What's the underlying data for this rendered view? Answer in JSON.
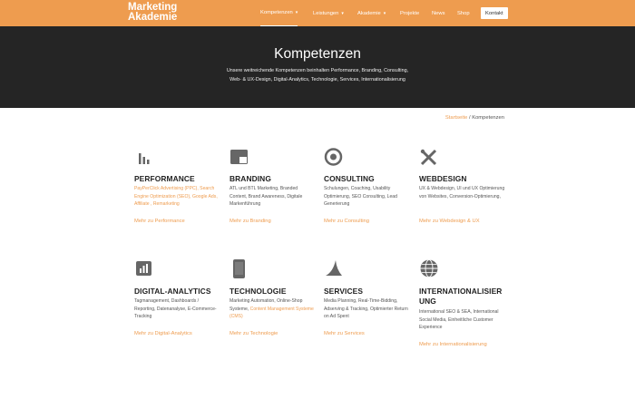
{
  "header": {
    "logo_line1": "Marketing",
    "logo_line2": "Akademie",
    "nav": [
      {
        "label": "Kompetenzen"
      },
      {
        "label": "Leistungen"
      },
      {
        "label": "Akademie"
      },
      {
        "label": "Projekte"
      },
      {
        "label": "News"
      },
      {
        "label": "Shop"
      }
    ],
    "contact_label": "Kontakt"
  },
  "hero": {
    "title": "Kompetenzen",
    "subtitle_line1": "Unsere weitreichende Kompetenzen beinhalten Performance, Branding, Consulting,",
    "subtitle_line2": "Web- & UX-Design, Digital-Analytics, Technologie, Services, Internationalisierung"
  },
  "breadcrumb": {
    "home": "Startseite",
    "separator": " / ",
    "current": "Kompetenzen"
  },
  "cards": [
    {
      "icon": "bar-chart-icon",
      "title": "PERFORMANCE",
      "desc_parts": [
        {
          "text": "PayPerClick Advertising (PPC), Search Engine Optimization (SEO), Google Ads, Affiliate , Remarketing",
          "highlight": true
        }
      ],
      "link": "Mehr zu Performance"
    },
    {
      "icon": "branding-icon",
      "title": "BRANDING",
      "desc_parts": [
        {
          "text": "ATL und BTL Marketing, Branded Content, Brand Awareness, Digitale Markenführung",
          "highlight": false
        }
      ],
      "link": "Mehr zu Branding"
    },
    {
      "icon": "target-icon",
      "title": "CONSULTING",
      "desc_parts": [
        {
          "text": "Schulungen, Coaching, Usability Optimierung, SEO Consulting, Lead Generierung",
          "highlight": false
        }
      ],
      "link": "Mehr zu Consulting"
    },
    {
      "icon": "design-tools-icon",
      "title": "WEBDESIGN",
      "desc_parts": [
        {
          "text": "UX & Webdesign, UI und UX Optimierung von Websites, Conversion-Optimierung,",
          "highlight": false
        }
      ],
      "link": "Mehr zu Webdesign & UX"
    },
    {
      "icon": "analytics-icon",
      "title": "DIGITAL-ANALYTICS",
      "desc_parts": [
        {
          "text": "Tagmanagement, Dashboards / Reporting, Datenanalyse, E-Commerce-Tracking",
          "highlight": false
        }
      ],
      "link": "Mehr zu Digital-Analytics"
    },
    {
      "icon": "mobile-icon",
      "title": "TECHNOLOGIE",
      "desc_parts": [
        {
          "text": "Marketing Automation, Online-Shop Systeme, ",
          "highlight": false
        },
        {
          "text": "Content Management Systeme (CMS)",
          "highlight": true
        }
      ],
      "link": "Mehr zu Technologie"
    },
    {
      "icon": "shark-fin-icon",
      "title": "SERVICES",
      "desc_parts": [
        {
          "text": "Media Planning, Real-Time-Bidding, Adserving & Tracking, Optimierter Return on Ad Spent",
          "highlight": false
        }
      ],
      "link": "Mehr zu Services"
    },
    {
      "icon": "globe-icon",
      "title": "INTERNATIONALISIERUNG",
      "title_line1": "INTERNATIONALISIER",
      "title_line2": "UNG",
      "desc_parts": [
        {
          "text": "International SEO & SEA, International Social Media, Einheitliche Customer Experience",
          "highlight": false
        }
      ],
      "link": "Mehr zu Internationalisierung"
    }
  ],
  "colors": {
    "accent": "#ee9c4f",
    "hero_bg": "#252525",
    "icon_gray": "#666666"
  }
}
